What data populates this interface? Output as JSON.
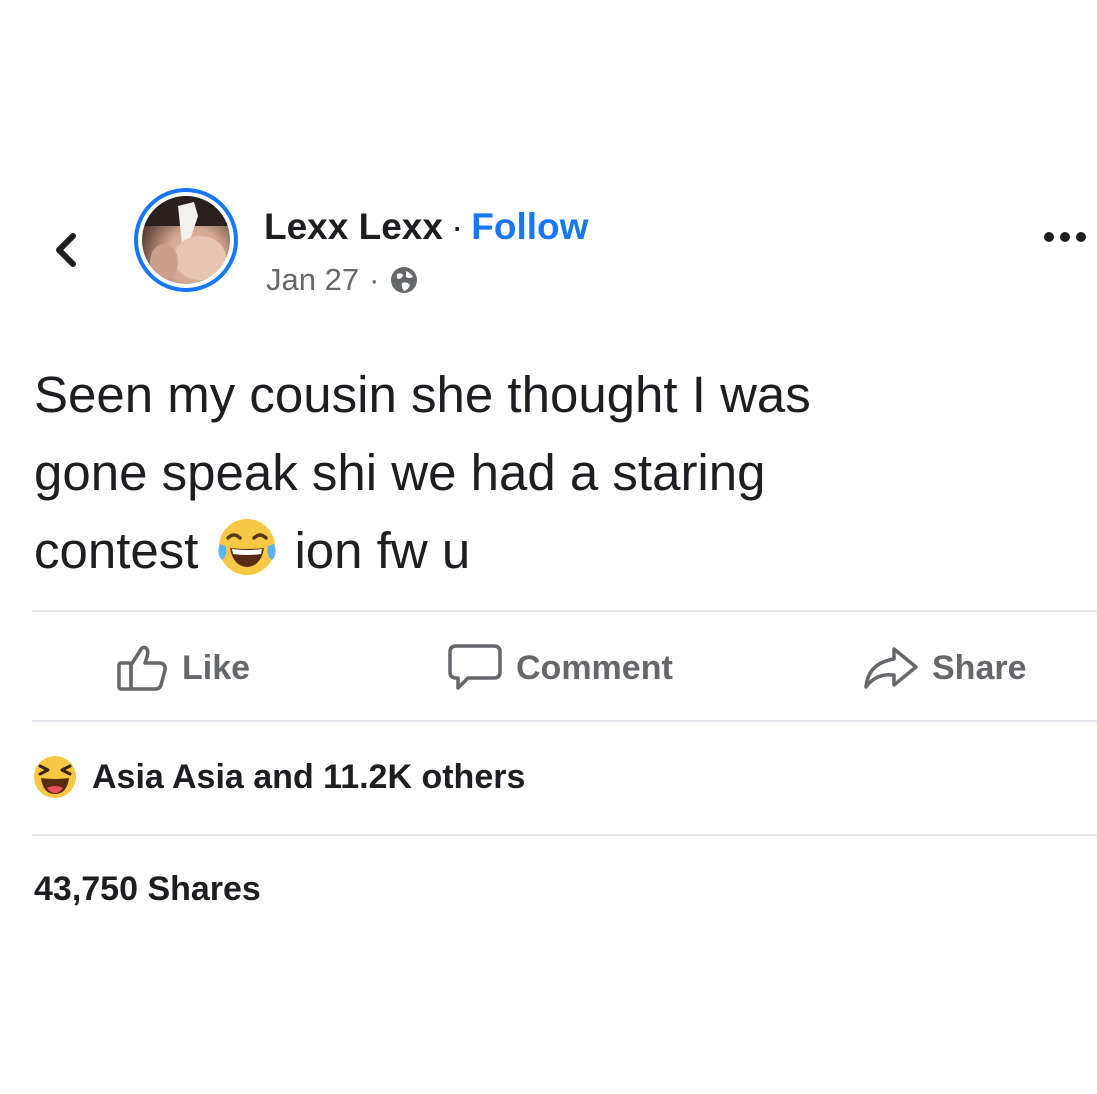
{
  "post": {
    "author": "Lexx Lexx",
    "separator": "·",
    "follow_label": "Follow",
    "date": "Jan 27",
    "text_line1": "Seen my cousin she thought I was",
    "text_line2": "gone speak shi we had a staring",
    "text_line3_before": "contest",
    "text_line3_after": "ion fw u",
    "inline_emoji": "laughing-with-tears-emoji"
  },
  "actions": {
    "like_label": "Like",
    "comment_label": "Comment",
    "share_label": "Share"
  },
  "reactions": {
    "summary": "Asia Asia and 11.2K others",
    "reaction_icon": "haha-emoji"
  },
  "shares": {
    "count_label": "43,750 Shares"
  },
  "colors": {
    "accent": "#1877f2",
    "text": "#1c1e21",
    "secondary_text": "#65676b",
    "divider": "#e4e6eb",
    "emoji_yellow": "#f7c843"
  }
}
